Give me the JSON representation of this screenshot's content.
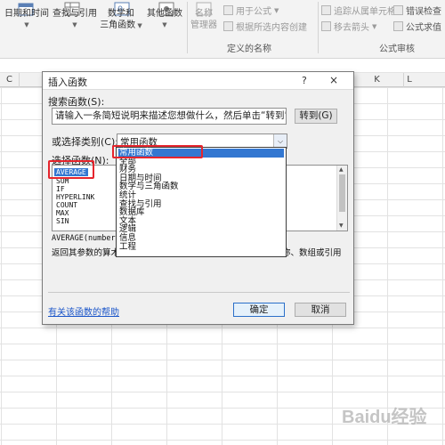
{
  "ribbon": {
    "datetime_label": "日期和时间",
    "lookup_label": "查找与引用",
    "math_line1": "数学和",
    "math_line2": "三角函数",
    "more_label": "其他函数",
    "name_mgr_line1": "名称",
    "name_mgr_line2": "管理器",
    "use_in_formula": "用于公式",
    "create_from_sel": "根据所选内容创建",
    "defined_names_group": "定义的名称",
    "trace_precedents": "追踪从属单元格",
    "remove_arrows": "移去箭头",
    "error_check": "错误检查",
    "eval_formula": "公式求值",
    "audit_group": "公式审核"
  },
  "columns": [
    "C",
    "D",
    "E",
    "F",
    "G",
    "H",
    "I",
    "J",
    "K",
    "L"
  ],
  "dialog": {
    "title": "插入函数",
    "help": "?",
    "close": "×",
    "search_label": "搜索函数(S):",
    "search_text": "请输入一条简短说明来描述您想做什么，然后单击“转到”",
    "go_button": "转到(G)",
    "category_label": "或选择类别(C):",
    "category_value": "常用函数",
    "function_list_label": "选择函数(N):",
    "functions": [
      "AVERAGE",
      "SUM",
      "IF",
      "HYPERLINK",
      "COUNT",
      "MAX",
      "SIN"
    ],
    "syntax": "AVERAGE(number1",
    "description_start": "返回其参数的算术",
    "description_end": "称、数组或引用",
    "help_link": "有关该函数的帮助",
    "ok_button": "确定",
    "cancel_button": "取消"
  },
  "dropdown": {
    "options": [
      "常用函数",
      "全部",
      "财务",
      "日期与时间",
      "数学与三角函数",
      "统计",
      "查找与引用",
      "数据库",
      "文本",
      "逻辑",
      "信息",
      "工程"
    ]
  },
  "watermark": "Baidu经验"
}
